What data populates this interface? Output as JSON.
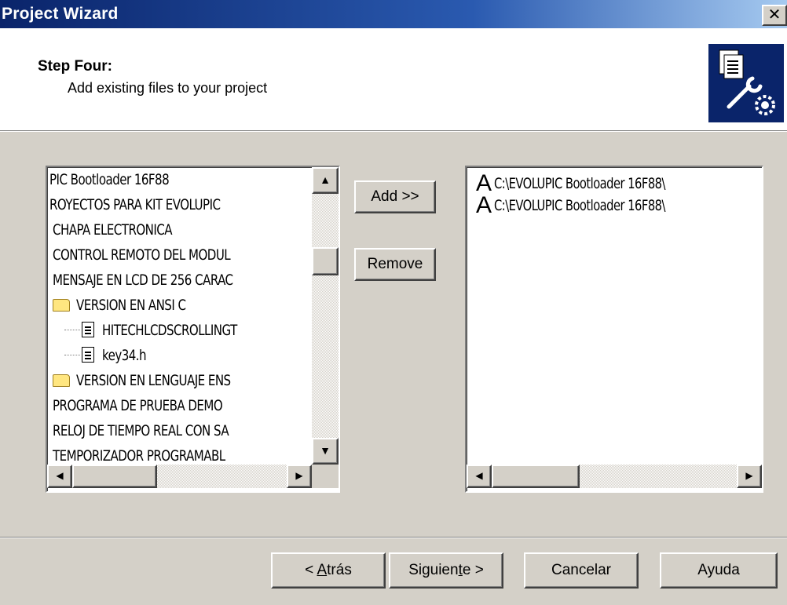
{
  "window": {
    "title": "Project Wizard",
    "close_glyph": "✕"
  },
  "header": {
    "step": "Step Four:",
    "subtitle": "Add existing files to your project"
  },
  "left_tree": {
    "items": [
      {
        "label": "PIC Bootloader 16F88",
        "type": "text"
      },
      {
        "label": "ROYECTOS PARA KIT EVOLUPIC",
        "type": "text"
      },
      {
        "label": "CHAPA ELECTRONICA",
        "type": "text"
      },
      {
        "label": "CONTROL REMOTO DEL MODUL",
        "type": "text"
      },
      {
        "label": "MENSAJE EN LCD DE 256 CARAC",
        "type": "text"
      },
      {
        "label": "VERSION EN ANSI C",
        "type": "folder"
      },
      {
        "label": "HITECHLCDSCROLLINGT",
        "type": "file"
      },
      {
        "label": "key34.h",
        "type": "file"
      },
      {
        "label": "VERSION EN LENGUAJE ENS",
        "type": "folder"
      },
      {
        "label": "PROGRAMA DE PRUEBA DEMO",
        "type": "text"
      },
      {
        "label": "RELOJ DE TIEMPO REAL CON SA",
        "type": "text"
      },
      {
        "label": "TEMPORIZADOR PROGRAMABL",
        "type": "text"
      }
    ]
  },
  "middle_buttons": {
    "add": "Add >>",
    "remove": "Remove"
  },
  "right_list": {
    "font_glyph": "A",
    "items": [
      "C:\\EVOLUPIC Bootloader 16F88\\",
      "C:\\EVOLUPIC Bootloader 16F88\\"
    ]
  },
  "footer": {
    "back_prefix": "< ",
    "back_mnemonic": "A",
    "back_rest": "trás",
    "next_prefix": "Siguien",
    "next_mnemonic": "t",
    "next_rest": "e >",
    "cancel": "Cancelar",
    "help": "Ayuda"
  },
  "icons": {
    "up": "▲",
    "down": "▼",
    "left": "◀",
    "right": "▶",
    "wizard": "documents-wrench-gear-icon"
  },
  "colors": {
    "title_bar": "#0a246a",
    "face": "#d4d0c8"
  }
}
